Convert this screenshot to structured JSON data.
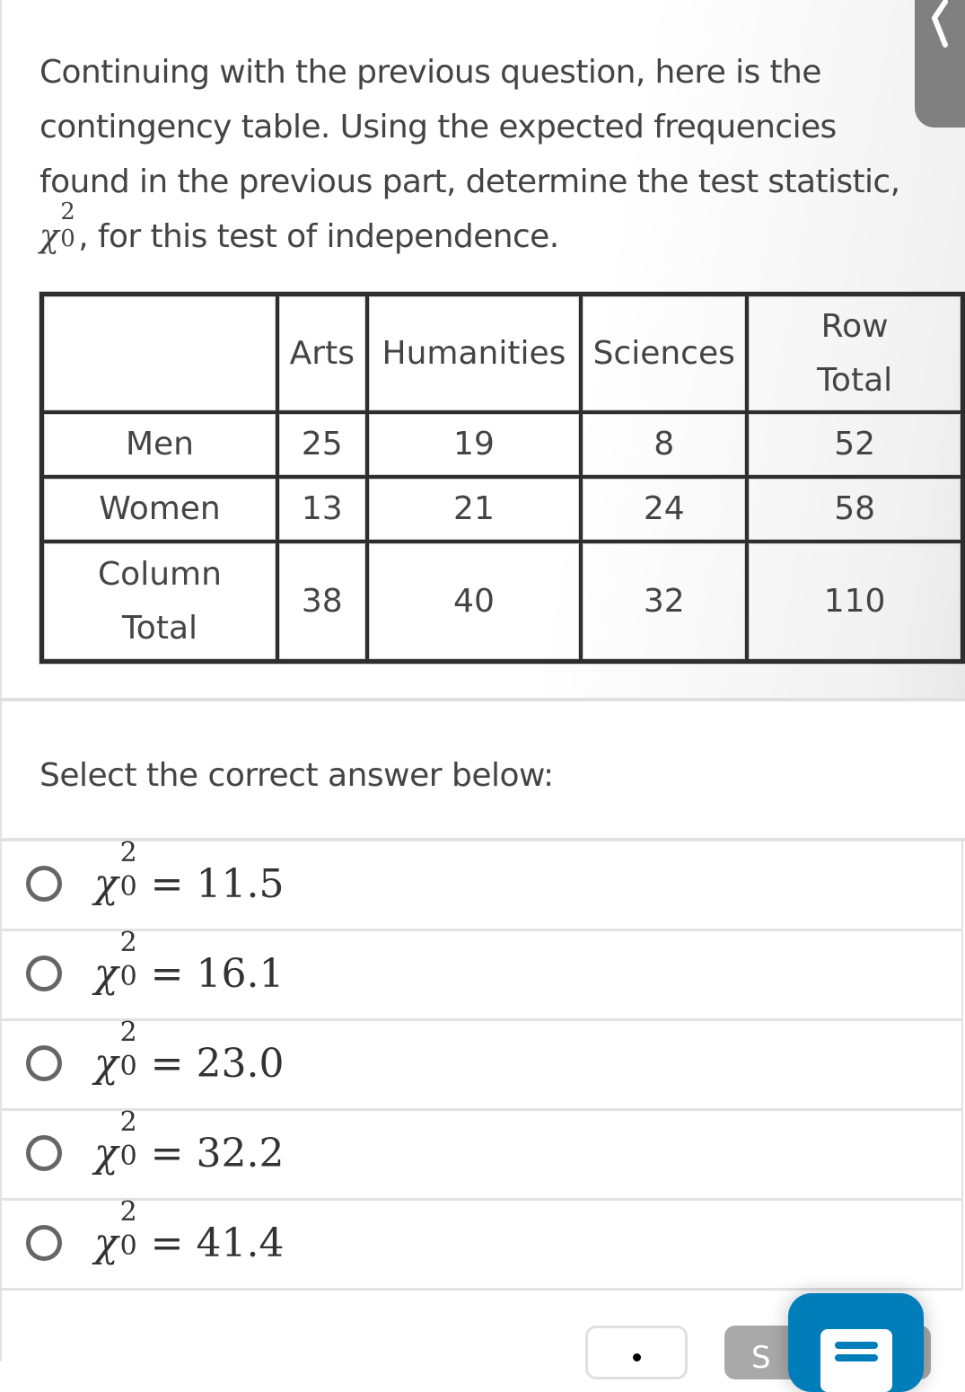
{
  "question": {
    "prompt_before": "Continuing with the previous question, here is the contingency table. Using the expected frequencies found in the previous part, determine the test statistic,",
    "symbol": "χ",
    "symbol_sup": "2",
    "symbol_sub": "0",
    "prompt_after": ", for this test of independence."
  },
  "back_tab": {
    "icon": "chevron-left-icon"
  },
  "table": {
    "headers": [
      "",
      "Arts",
      "Humanities",
      "Sciences",
      "Row Total"
    ],
    "rows": [
      {
        "label": "Men",
        "values": [
          "25",
          "19",
          "8",
          "52"
        ]
      },
      {
        "label": "Women",
        "values": [
          "13",
          "21",
          "24",
          "58"
        ]
      },
      {
        "label": "Column Total",
        "values": [
          "38",
          "40",
          "32",
          "110"
        ]
      }
    ]
  },
  "answers": {
    "instruction": "Select the correct answer below:",
    "options": [
      {
        "symbol": "χ",
        "sup": "2",
        "sub": "0",
        "eq": "=",
        "value": "11.5",
        "selected": false
      },
      {
        "symbol": "χ",
        "sup": "2",
        "sub": "0",
        "eq": "=",
        "value": "16.1",
        "selected": false
      },
      {
        "symbol": "χ",
        "sup": "2",
        "sub": "0",
        "eq": "=",
        "value": "23.0",
        "selected": false
      },
      {
        "symbol": "χ",
        "sup": "2",
        "sub": "0",
        "eq": "=",
        "value": "32.2",
        "selected": false
      },
      {
        "symbol": "χ",
        "sup": "2",
        "sub": "0",
        "eq": "=",
        "value": "41.4",
        "selected": false
      }
    ]
  },
  "footer": {
    "more_button_icon": "more-dots-icon",
    "submit_label_partial": "S",
    "chat_button_icon": "chat-document-icon"
  },
  "colors": {
    "accent": "#017dba",
    "submit_disabled": "#a9a9a9",
    "back_tab": "#808080"
  }
}
